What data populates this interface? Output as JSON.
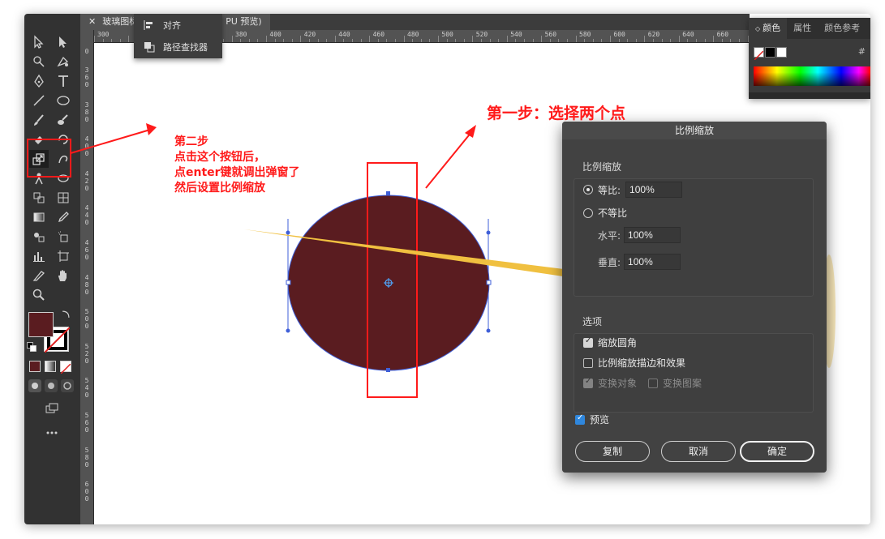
{
  "document_tab": {
    "title": "玻璃图标",
    "suffix": "PU 预览)"
  },
  "menu": {
    "items": [
      {
        "label": "对齐"
      },
      {
        "label": "路径查找器"
      }
    ]
  },
  "color_panel": {
    "tabs": [
      {
        "label": "颜色"
      },
      {
        "label": "属性"
      },
      {
        "label": "颜色参考"
      }
    ],
    "hash": "#"
  },
  "ruler_top": [
    "300",
    "380",
    "400",
    "420",
    "440",
    "460",
    "480",
    "500",
    "520",
    "540",
    "560",
    "580",
    "600",
    "620",
    "640",
    "660"
  ],
  "ruler_left": [
    "0",
    "3 6 0",
    "3 8 0",
    "4 0 0",
    "4 2 0",
    "4 4 0",
    "4 6 0",
    "4 8 0",
    "5 0 0",
    "5 2 0",
    "5 4 0",
    "5 6 0",
    "5 8 0",
    "6 0 0"
  ],
  "dialog": {
    "title": "比例缩放",
    "scale_group_label": "比例缩放",
    "uniform": {
      "label": "等比:",
      "value": "100%"
    },
    "non_uniform": {
      "label": "不等比"
    },
    "horizontal": {
      "label": "水平:",
      "value": "100%"
    },
    "vertical": {
      "label": "垂直:",
      "value": "100%"
    },
    "options_group_label": "选项",
    "scale_corners": "缩放圆角",
    "scale_strokes": "比例缩放描边和效果",
    "transform_objects": "变换对象",
    "transform_patterns": "变换图案",
    "preview": "预览",
    "buttons": {
      "copy": "复制",
      "cancel": "取消",
      "ok": "确定"
    }
  },
  "annotations": {
    "step1": "第一步：选择两个点",
    "step2_lines": [
      "第二步",
      "点击这个按钮后，",
      "点enter键就调出弹窗了",
      "然后设置比例缩放"
    ]
  },
  "colors": {
    "ellipse_fill": "#5a1c20",
    "annotation_red": "#ff1a1a",
    "arrow_yellow": "#f0c040",
    "selection_blue": "#3f5fd8"
  }
}
